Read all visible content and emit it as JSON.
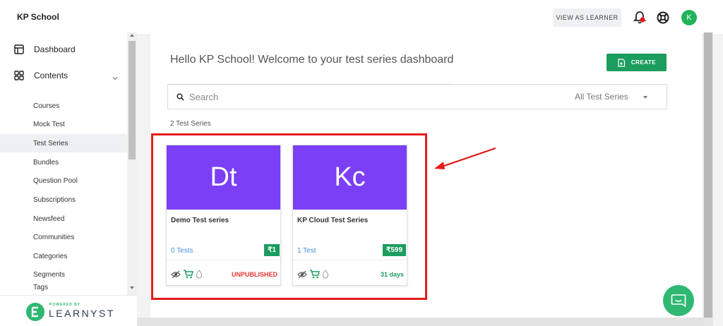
{
  "app": {
    "brand": "KP School"
  },
  "header": {
    "view_as_learner": "VIEW AS LEARNER",
    "avatar_initial": "K"
  },
  "sidebar": {
    "dashboard": "Dashboard",
    "contents": "Contents",
    "items": [
      {
        "label": "Courses"
      },
      {
        "label": "Mock Test"
      },
      {
        "label": "Test Series"
      },
      {
        "label": "Bundles"
      },
      {
        "label": "Question Pool"
      },
      {
        "label": "Subscriptions"
      },
      {
        "label": "Newsfeed"
      },
      {
        "label": "Communities"
      },
      {
        "label": "Categories"
      },
      {
        "label": "Segments"
      },
      {
        "label": "Tags"
      }
    ],
    "active_item": "Test Series",
    "powered_by": "POWERED BY",
    "logo_text": "LEARNYST"
  },
  "main": {
    "welcome": "Hello KP School! Welcome to your test series dashboard",
    "create_label": "CREATE",
    "search_placeholder": "Search",
    "filter_label": "All Test Series",
    "count_label": "2 Test Series",
    "cards": [
      {
        "initials": "Dt",
        "title": "Demo Test series",
        "tests": "0 Tests",
        "price": "₹1",
        "status": "UNPUBLISHED"
      },
      {
        "initials": "Kc",
        "title": "KP Cloud Test Series",
        "tests": "1 Test",
        "price": "₹599",
        "status": "31 days"
      }
    ]
  },
  "colors": {
    "accent_green": "#1b9d5e",
    "banner_purple": "#7b3ff5",
    "highlight_red": "#e31b1b",
    "unpublished_red": "#e53935",
    "link_blue": "#4a90e2"
  },
  "icons": [
    "bell-icon",
    "lifebuoy-icon",
    "dashboard-icon",
    "contents-icon",
    "chevron-down-icon",
    "create-icon",
    "search-icon",
    "hidden-eye-icon",
    "cart-icon",
    "drop-icon",
    "chat-icon",
    "learnyst-logo-icon"
  ]
}
